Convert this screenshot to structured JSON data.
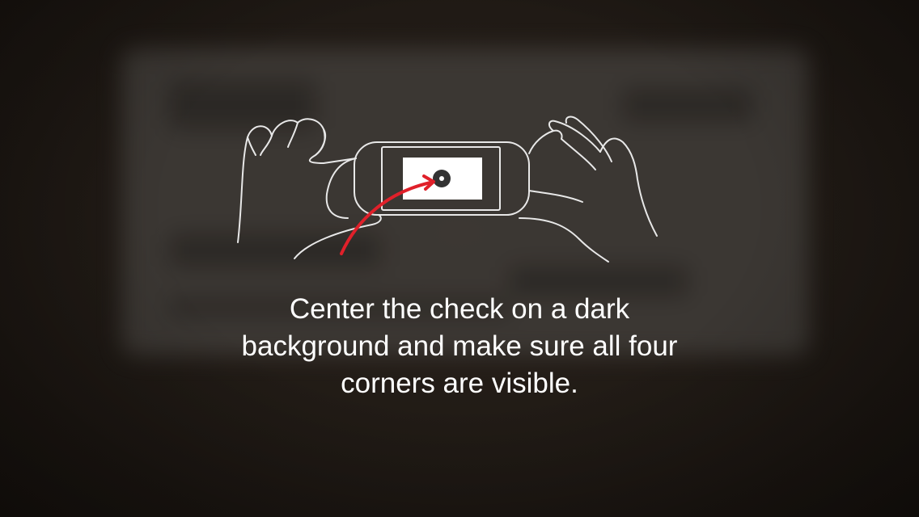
{
  "instruction": {
    "text": "Center the check on a dark background and make sure all four corners are visible."
  },
  "illustration": {
    "description_icon": "hands-holding-phone-icon",
    "arrow_color": "#e0202a",
    "line_color": "#e8e8e8"
  },
  "colors": {
    "background": "#1c1612",
    "text": "#ffffff"
  }
}
